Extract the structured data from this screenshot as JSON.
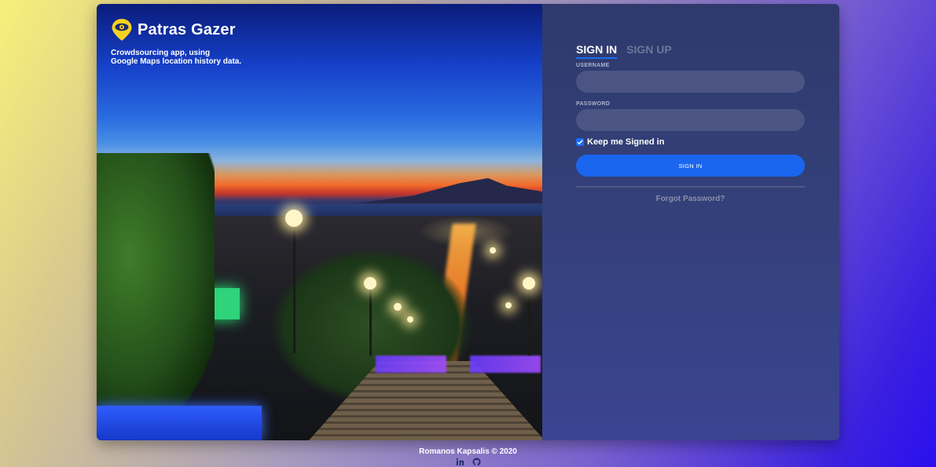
{
  "brand": {
    "name": "Patras Gazer",
    "tagline_line1": "Crowdsourcing app, using",
    "tagline_line2": "Google Maps location history data.",
    "icon": "eye-location-pin-icon",
    "icon_color": "#f4d21f"
  },
  "auth": {
    "tabs": [
      {
        "label": "SIGN IN",
        "active": true
      },
      {
        "label": "SIGN UP",
        "active": false
      }
    ],
    "username": {
      "label": "USERNAME",
      "value": "",
      "placeholder": ""
    },
    "password": {
      "label": "PASSWORD",
      "value": "",
      "placeholder": ""
    },
    "keep_signed_in": {
      "label": "Keep me Signed in",
      "checked": true
    },
    "submit_label": "SIGN IN",
    "forgot_label": "Forgot Password?"
  },
  "footer": {
    "credit": "Romanos Kapsalis © 2020",
    "icons": [
      "linkedin-icon",
      "github-icon"
    ]
  },
  "colors": {
    "accent": "#1a66ee",
    "panel_bg": "#34407a",
    "input_bg": "#4b5483"
  }
}
